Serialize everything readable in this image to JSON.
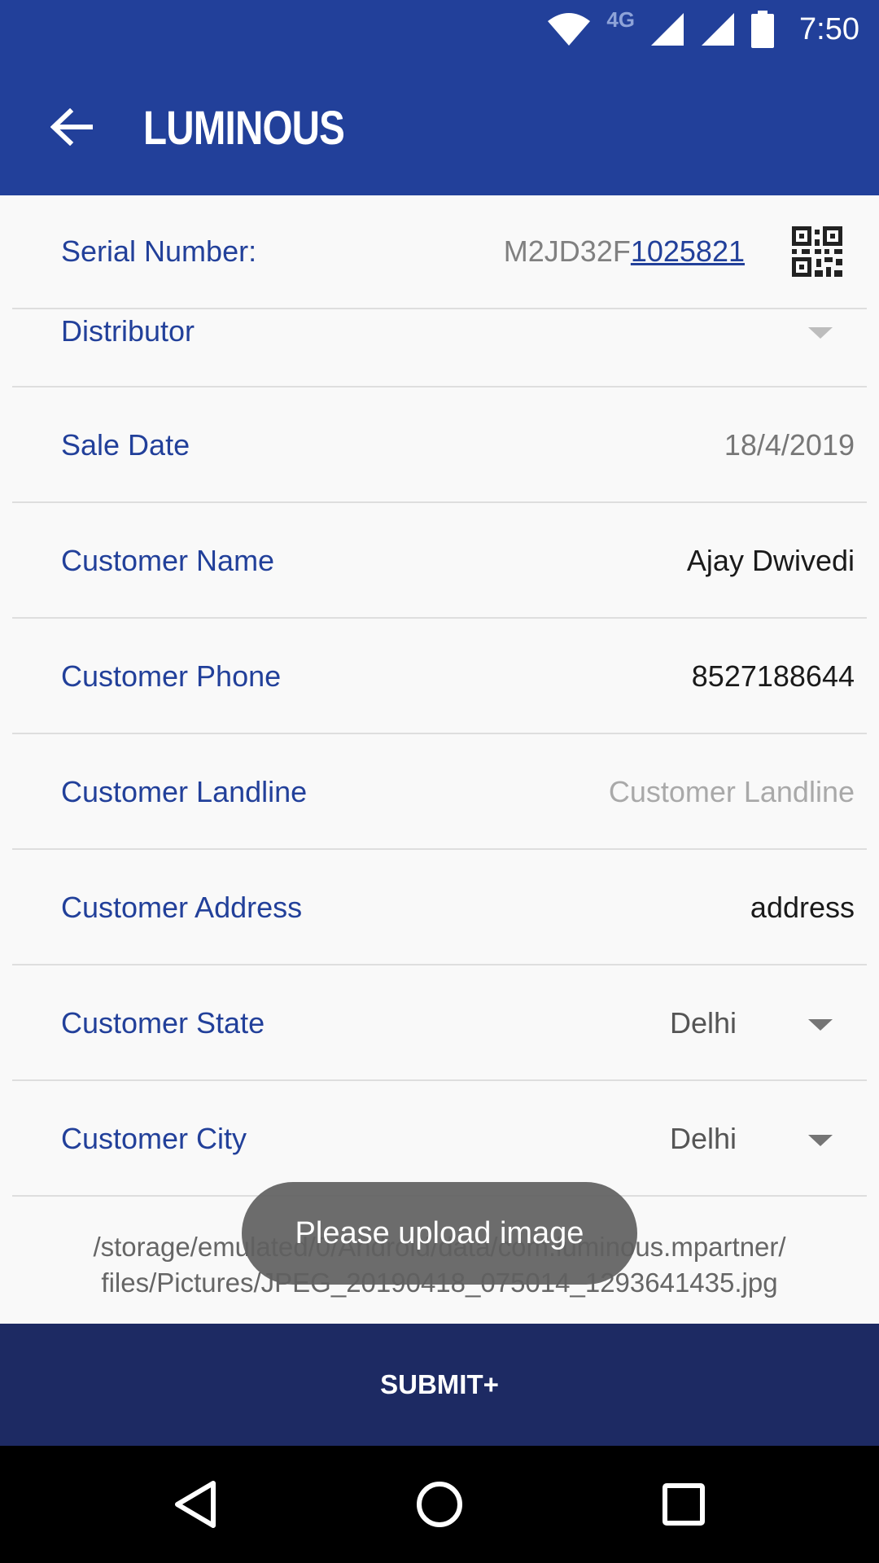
{
  "status_bar": {
    "network": "4G",
    "time": "7:50"
  },
  "app_bar": {
    "brand": "LUMINOUS"
  },
  "form": {
    "serial": {
      "label": "Serial Number:",
      "prefix": "M2JD32F",
      "link": "1025821"
    },
    "distributor": {
      "label": "Distributor"
    },
    "sale_date": {
      "label": "Sale Date",
      "value": "18/4/2019"
    },
    "customer_name": {
      "label": "Customer Name",
      "value": "Ajay Dwivedi"
    },
    "customer_phone": {
      "label": "Customer Phone",
      "value": "8527188644"
    },
    "customer_landline": {
      "label": "Customer Landline",
      "placeholder": "Customer Landline"
    },
    "customer_address": {
      "label": "Customer Address",
      "value": "address"
    },
    "customer_state": {
      "label": "Customer State",
      "value": "Delhi"
    },
    "customer_city": {
      "label": "Customer City",
      "value": "Delhi"
    },
    "file_path_line1": "/storage/emulated/0/Android/data/com.luminous.mpartner/",
    "file_path_line2": "files/Pictures/JPEG_20190418_075014_1293641435.jpg"
  },
  "toast": "Please upload image",
  "submit": {
    "label": "SUBMIT+"
  },
  "colors": {
    "primary": "#22409a",
    "submit_bar": "#1d2a63",
    "label_text": "#22409a"
  }
}
